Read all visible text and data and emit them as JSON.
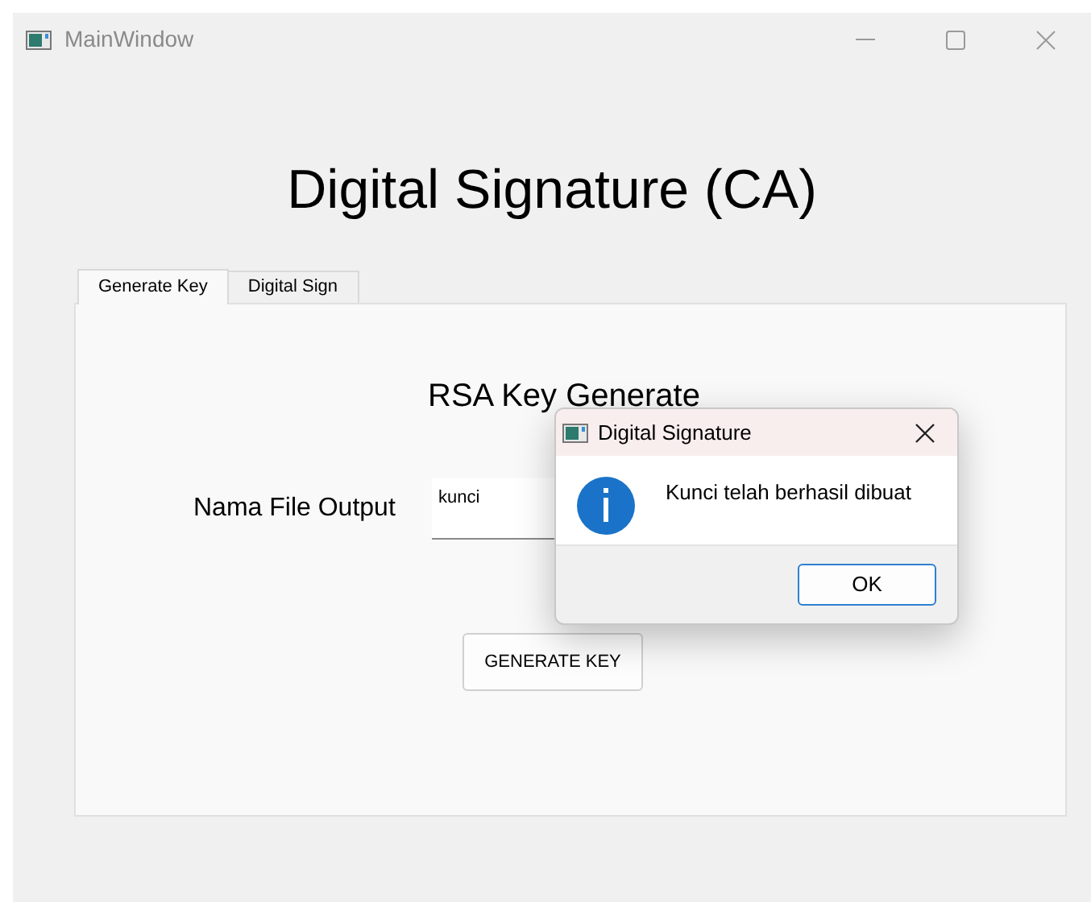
{
  "window": {
    "title": "MainWindow"
  },
  "heading": "Digital Signature (CA)",
  "tabs": [
    {
      "label": "Generate Key",
      "selected": true
    },
    {
      "label": "Digital Sign",
      "selected": false
    }
  ],
  "panel": {
    "title": "RSA Key Generate",
    "field_label": "Nama File Output",
    "field_value": "kunci",
    "button": "GENERATE KEY"
  },
  "dialog": {
    "title": "Digital Signature",
    "message": "Kunci telah berhasil dibuat",
    "button": "OK"
  }
}
